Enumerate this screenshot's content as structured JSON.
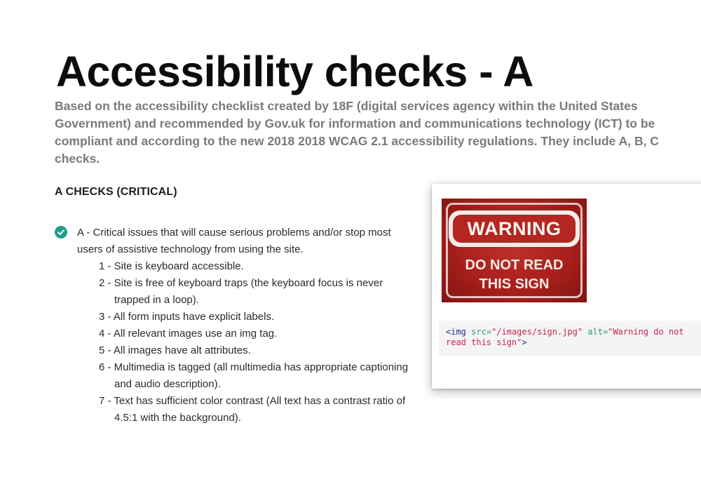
{
  "page": {
    "title": "Accessibility checks - A",
    "intro": "Based on the accessibility checklist created by 18F (digital services agency within the United States Government) and recommended by Gov.uk for information and communications technology (ICT) to be compliant and according to the new 2018 2018 WCAG 2.1 accessibility regulations. They include A, B, C checks."
  },
  "section": {
    "heading": "A CHECKS (CRITICAL)",
    "check_icon": "check-circle-icon",
    "check_color": "#1a9e8f",
    "description": "A - Critical issues that will cause serious problems and/or stop most users of assistive technology from using the site.",
    "items": [
      "1 - Site is keyboard accessible.",
      "2 - Site is free of keyboard traps (the keyboard focus is never trapped in a loop).",
      "3 - All form inputs have explicit labels.",
      "4 - All relevant images use an img tag.",
      "5 - All images have alt attributes.",
      "6 - Multimedia is tagged (all multimedia has appropriate captioning and audio description).",
      "7 - Text has sufficient color contrast (All text has a contrast ratio of 4.5:1 with the background)."
    ]
  },
  "example": {
    "sign_title": "WARNING",
    "sign_line1": "DO NOT READ",
    "sign_line2": "THIS SIGN",
    "code": {
      "open": "<img",
      "src_attr": "src=",
      "src_value": "\"/images/sign.jpg\"",
      "alt_attr": "alt=",
      "alt_value_1": "\"Warning do not",
      "alt_value_2": "read this sign\"",
      "close": ">"
    }
  }
}
